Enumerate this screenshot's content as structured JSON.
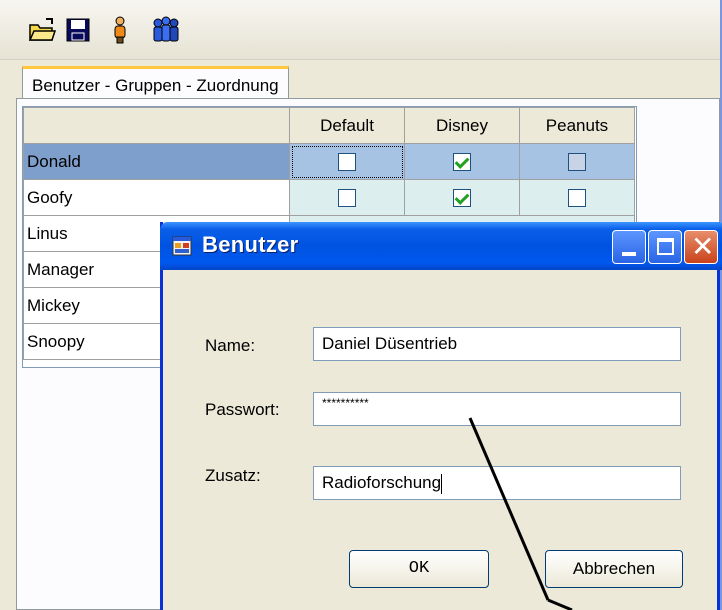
{
  "toolbar": {
    "buttons": [
      {
        "icon": "open-folder-icon"
      },
      {
        "icon": "save-icon"
      },
      {
        "icon": "user-icon"
      },
      {
        "icon": "users-group-icon"
      }
    ]
  },
  "tabs": [
    {
      "label": "Benutzer - Gruppen - Zuordnung",
      "active": true
    }
  ],
  "grid": {
    "columns": [
      "Default",
      "Disney",
      "Peanuts"
    ],
    "rows": [
      {
        "name": "Donald",
        "selected": true,
        "values": [
          false,
          true,
          false
        ]
      },
      {
        "name": "Goofy",
        "selected": false,
        "values": [
          false,
          true,
          false
        ]
      },
      {
        "name": "Linus"
      },
      {
        "name": "Manager"
      },
      {
        "name": "Mickey"
      },
      {
        "name": "Snoopy"
      }
    ]
  },
  "dialog": {
    "title": "Benutzer",
    "fields": {
      "name": {
        "label": "Name:",
        "value": "Daniel Düsentrieb"
      },
      "password": {
        "label": "Passwort:",
        "value": "**********"
      },
      "extra": {
        "label": "Zusatz:",
        "value": "Radioforschung"
      }
    },
    "ok_label": "OK",
    "cancel_label": "Abbrechen"
  },
  "colors": {
    "titlebar": "#0053e1",
    "selection": "#7e9fcb",
    "check": "#21a121"
  }
}
